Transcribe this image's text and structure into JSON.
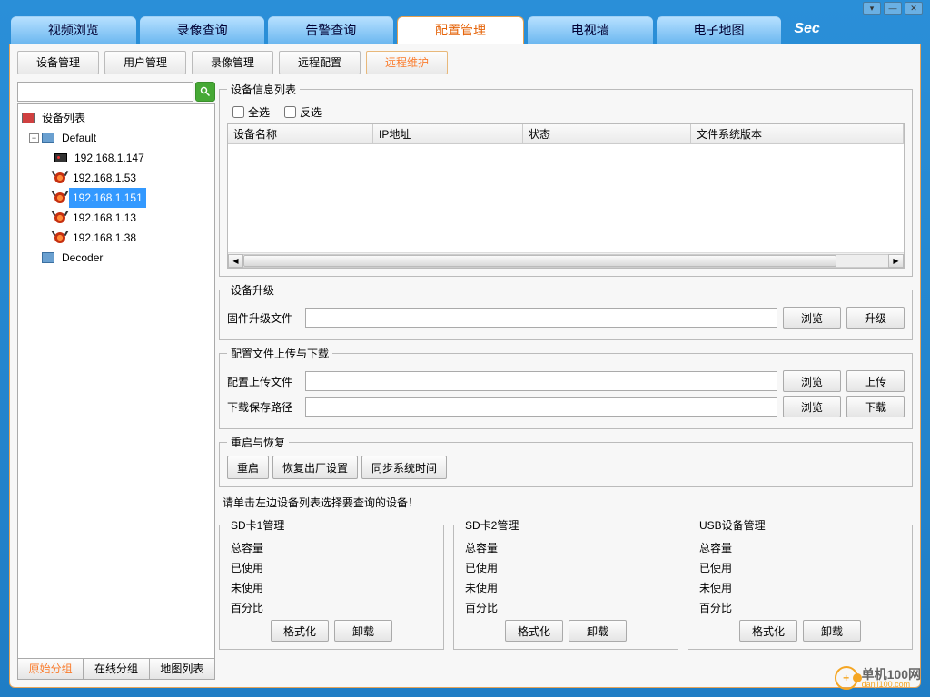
{
  "titlebar": {
    "dropdown": "▾",
    "minimize": "—",
    "close": "✕"
  },
  "mainTabs": [
    "视频浏览",
    "录像查询",
    "告警查询",
    "配置管理",
    "电视墙",
    "电子地图"
  ],
  "mainTabActive": 3,
  "brand": "Sec",
  "subTabs": [
    "设备管理",
    "用户管理",
    "录像管理",
    "远程配置",
    "远程维护"
  ],
  "subTabActive": 4,
  "search": {
    "value": "",
    "placeholder": ""
  },
  "tree": {
    "root": "设备列表",
    "groups": [
      {
        "name": "Default",
        "children": [
          {
            "label": "192.168.1.147",
            "icon": "dvr"
          },
          {
            "label": "192.168.1.53",
            "icon": "cam"
          },
          {
            "label": "192.168.1.151",
            "icon": "cam",
            "selected": true
          },
          {
            "label": "192.168.1.13",
            "icon": "cam"
          },
          {
            "label": "192.168.1.38",
            "icon": "cam"
          }
        ]
      },
      {
        "name": "Decoder",
        "children": []
      }
    ]
  },
  "sidebarBottom": [
    "原始分组",
    "在线分组",
    "地图列表"
  ],
  "sidebarBottomActive": 0,
  "deviceInfo": {
    "legend": "设备信息列表",
    "selectAll": "全选",
    "invert": "反选",
    "columns": [
      "设备名称",
      "IP地址",
      "状态",
      "文件系统版本"
    ],
    "rows": []
  },
  "upgrade": {
    "legend": "设备升级",
    "fileLabel": "固件升级文件",
    "browse": "浏览",
    "upgrade": "升级"
  },
  "config": {
    "legend": "配置文件上传与下载",
    "uploadLabel": "配置上传文件",
    "downloadLabel": "下载保存路径",
    "browse": "浏览",
    "upload": "上传",
    "download": "下载"
  },
  "restart": {
    "legend": "重启与恢复",
    "restart": "重启",
    "factory": "恢复出厂设置",
    "syncTime": "同步系统时间"
  },
  "hint": "请单击左边设备列表选择要查询的设备！",
  "storage": {
    "cards": [
      {
        "legend": "SD卡1管理"
      },
      {
        "legend": "SD卡2管理"
      },
      {
        "legend": "USB设备管理"
      }
    ],
    "lines": [
      "总容量",
      "已使用",
      "未使用",
      "百分比"
    ],
    "format": "格式化",
    "unmount": "卸载"
  },
  "watermark": {
    "text1": "单机100网",
    "text2": "danji100.com",
    "logo": "+"
  }
}
